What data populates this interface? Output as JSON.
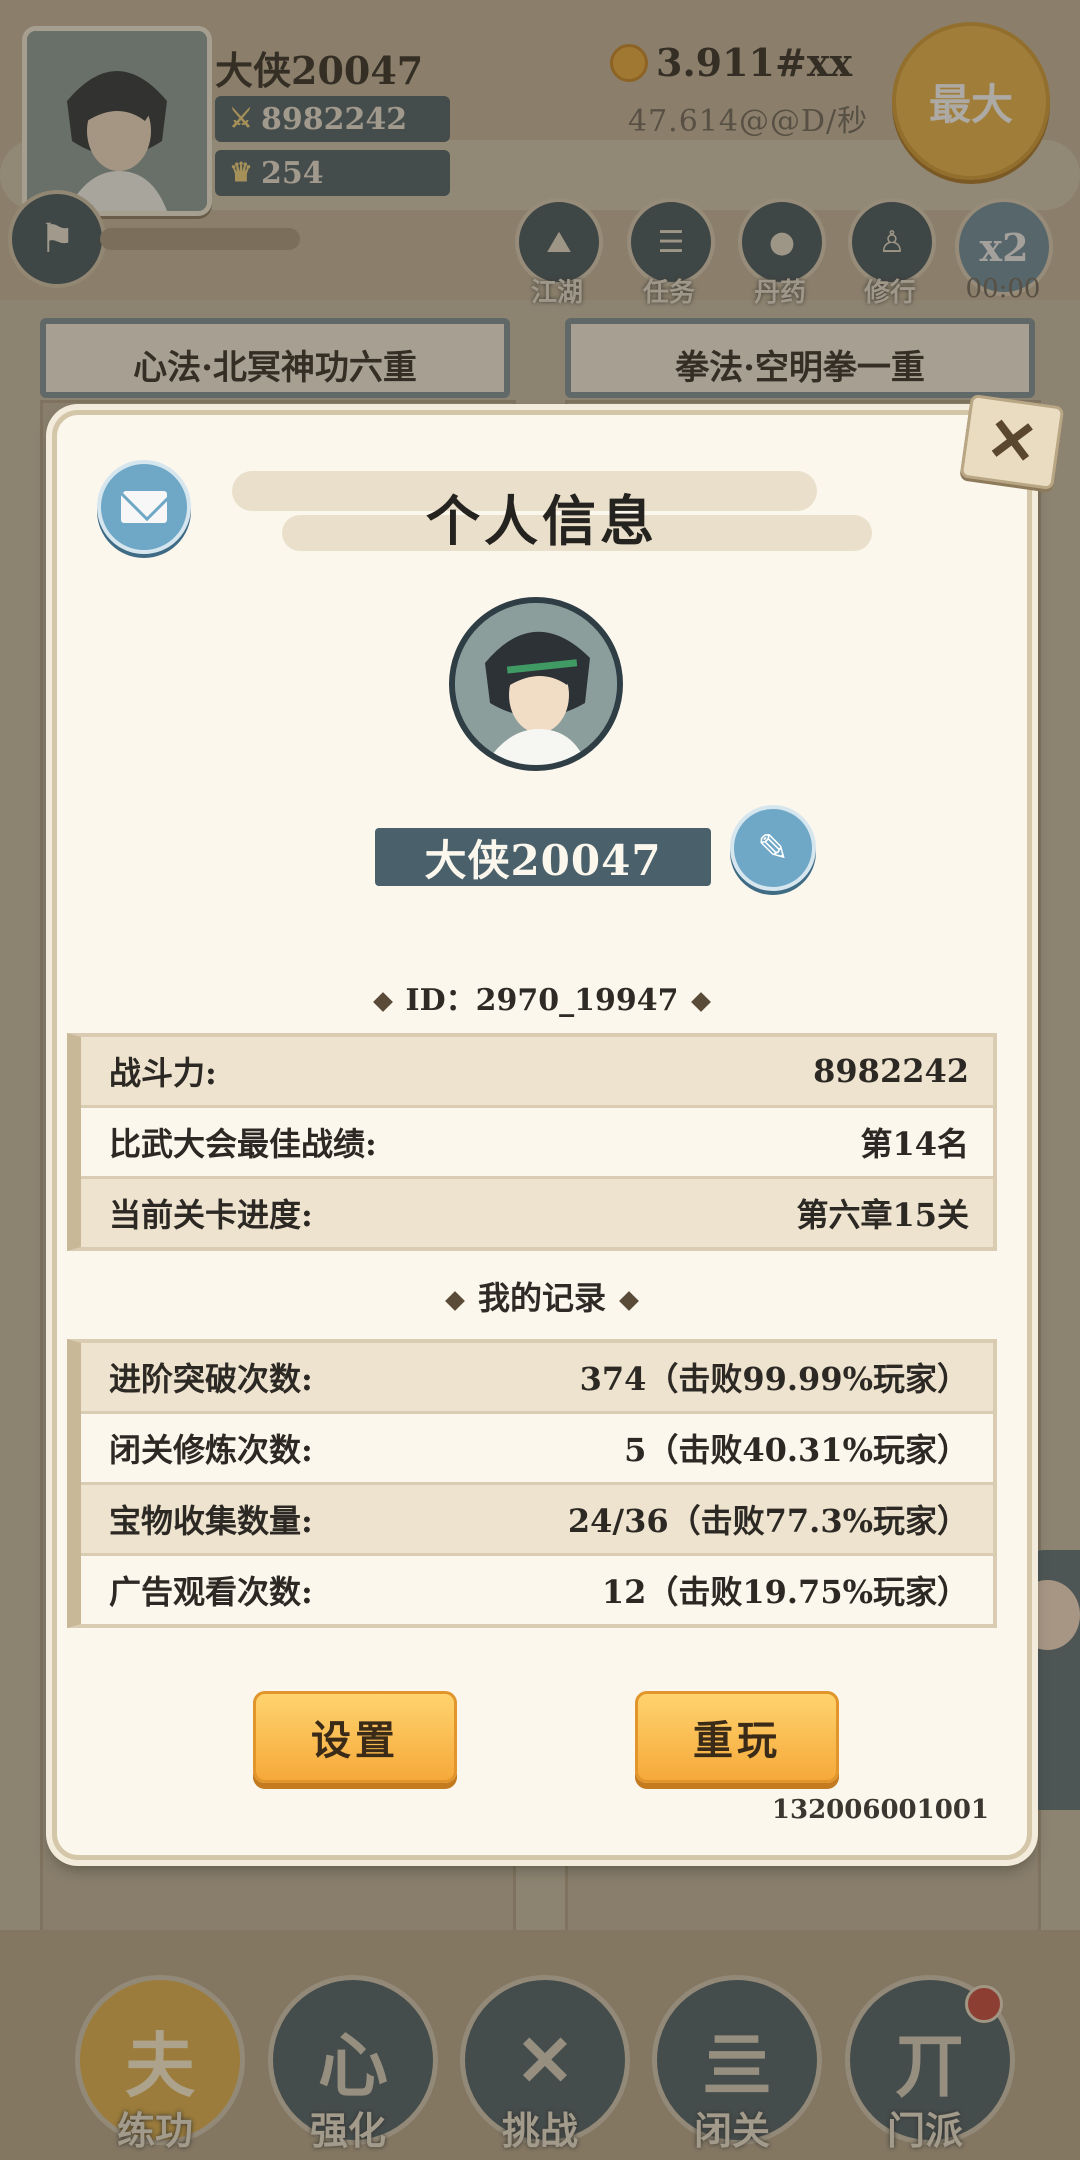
{
  "hud": {
    "player_name": "大侠20047",
    "power": "8982242",
    "gold_ingots": "254",
    "coins": "3.911#xx",
    "coin_rate": "47.614@@D/秒",
    "max_label": "最大",
    "x2_label": "x2",
    "timer": "00:00",
    "nav": [
      {
        "label": "江湖"
      },
      {
        "label": "任务"
      },
      {
        "label": "丹药"
      },
      {
        "label": "修行"
      }
    ],
    "skill_cards": [
      "心法·北冥神功六重",
      "拳法·空明拳一重"
    ]
  },
  "bottom_nav": [
    {
      "label": "练功",
      "glyph": "夫"
    },
    {
      "label": "强化",
      "glyph": "心"
    },
    {
      "label": "挑战",
      "glyph": "✕"
    },
    {
      "label": "闭关",
      "glyph": "亖"
    },
    {
      "label": "门派",
      "glyph": "丌"
    }
  ],
  "dialog": {
    "title": "个人信息",
    "player_name": "大侠20047",
    "id_text": "ID：2970_19947",
    "stats": [
      {
        "label": "战斗力:",
        "value": "8982242"
      },
      {
        "label": "比武大会最佳战绩:",
        "value": "第14名"
      },
      {
        "label": "当前关卡进度:",
        "value": "第六章15关"
      }
    ],
    "records_title": "我的记录",
    "records": [
      {
        "label": "进阶突破次数:",
        "value": "374（击败99.99%玩家）"
      },
      {
        "label": "闭关修炼次数:",
        "value": "5（击败40.31%玩家）"
      },
      {
        "label": "宝物收集数量:",
        "value": "24/36（击败77.3%玩家）"
      },
      {
        "label": "广告观看次数:",
        "value": "12（击败19.75%玩家）"
      }
    ],
    "settings_label": "设置",
    "replay_label": "重玩",
    "version": "132006001001"
  }
}
